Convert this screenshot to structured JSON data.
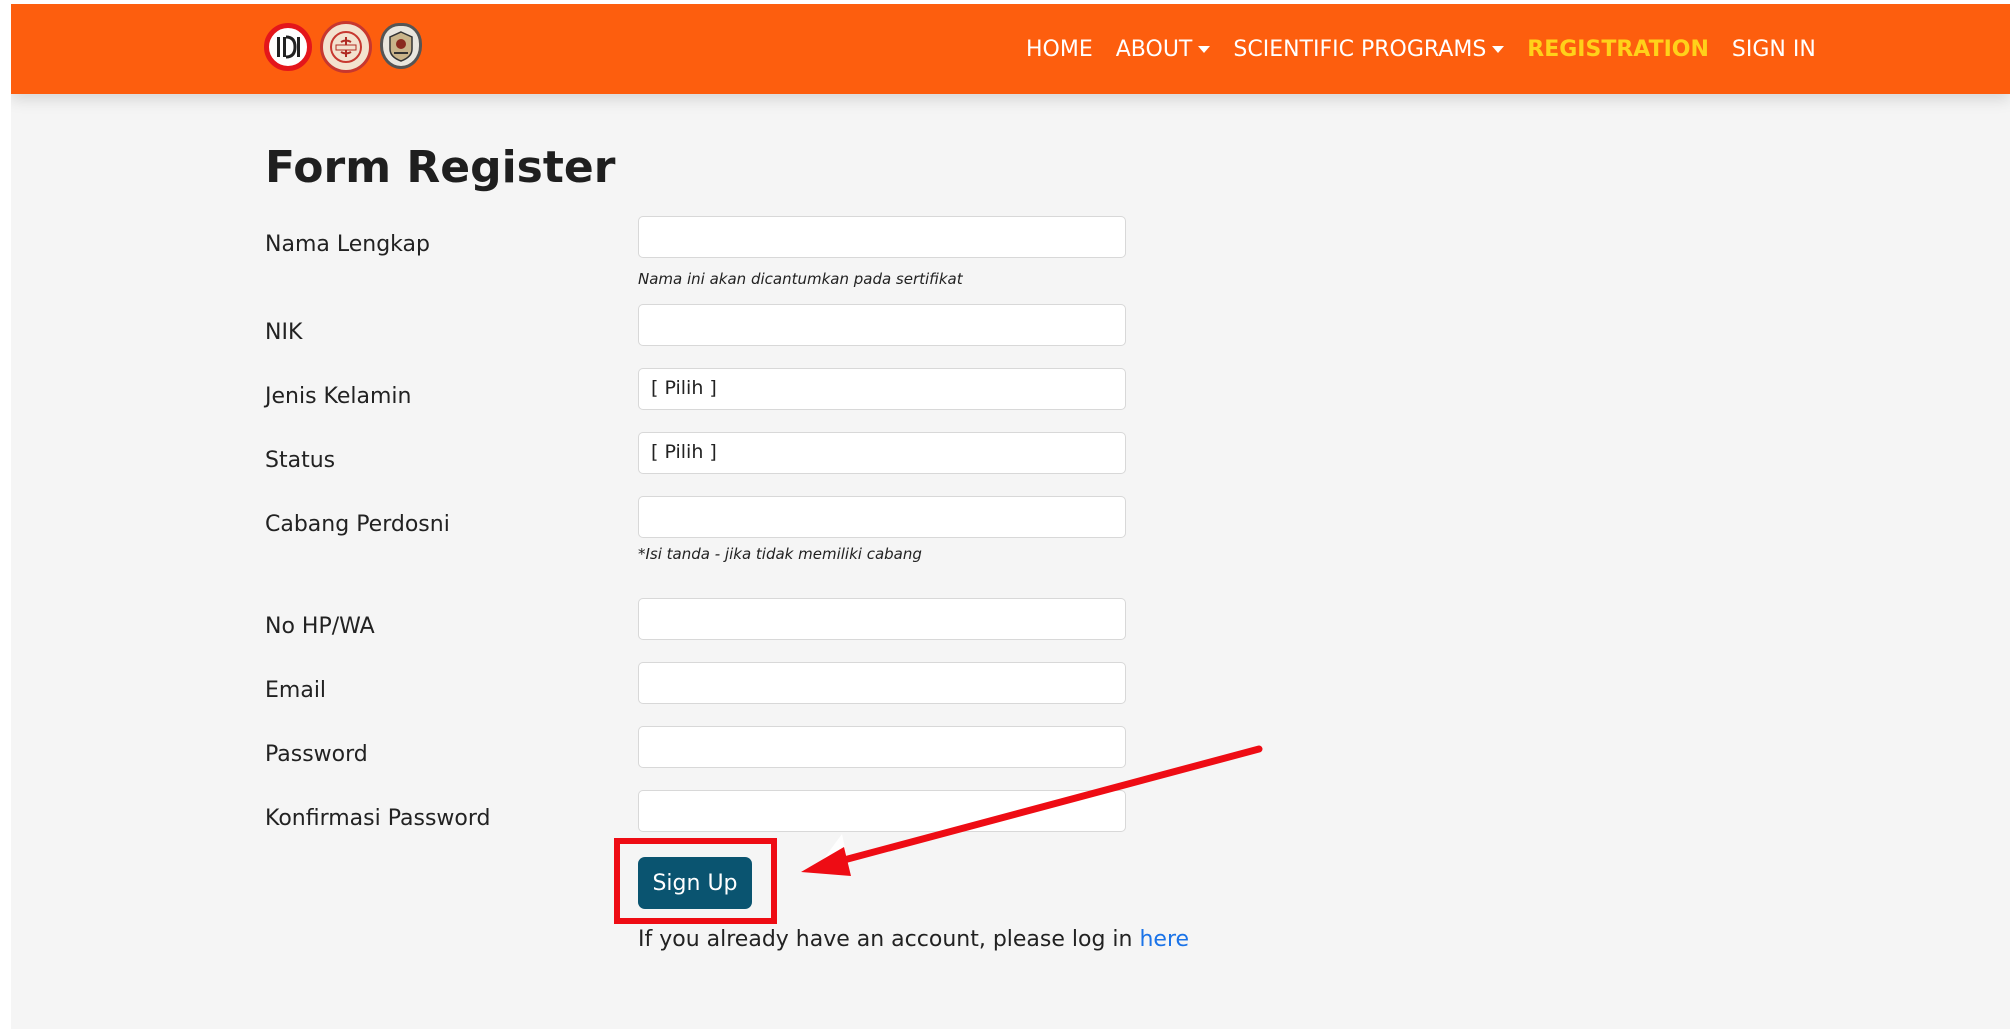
{
  "navbar": {
    "logos": [
      {
        "name": "idi-logo",
        "text": ""
      },
      {
        "name": "perdosni-logo",
        "text": ""
      },
      {
        "name": "university-logo",
        "text": ""
      }
    ],
    "links": [
      {
        "label": "HOME",
        "dropdown": false,
        "active": false
      },
      {
        "label": "ABOUT",
        "dropdown": true,
        "active": false
      },
      {
        "label": "SCIENTIFIC PROGRAMS",
        "dropdown": true,
        "active": false
      },
      {
        "label": "REGISTRATION",
        "dropdown": false,
        "active": true
      },
      {
        "label": "SIGN IN",
        "dropdown": false,
        "active": false
      }
    ],
    "colors": {
      "background": "#fd5e0e",
      "active": "#ffd11a"
    }
  },
  "form": {
    "title": "Form Register",
    "fields": {
      "nama": {
        "label": "Nama Lengkap",
        "value": "",
        "hint": "Nama ini akan dicantumkan pada sertifikat"
      },
      "nik": {
        "label": "NIK",
        "value": ""
      },
      "jenis_kelamin": {
        "label": "Jenis Kelamin",
        "selected": "[ Pilih ]"
      },
      "status": {
        "label": "Status",
        "selected": "[ Pilih ]"
      },
      "cabang": {
        "label": "Cabang Perdosni",
        "value": "",
        "hint": "*Isi tanda - jika tidak memiliki cabang"
      },
      "hp": {
        "label": "No HP/WA",
        "value": ""
      },
      "email": {
        "label": "Email",
        "value": ""
      },
      "password": {
        "label": "Password",
        "value": ""
      },
      "konfirmasi": {
        "label": "Konfirmasi Password",
        "value": ""
      }
    },
    "submit_label": "Sign Up",
    "login_prompt": "If you already have an account, please log in ",
    "login_link": "here",
    "colors": {
      "button": "#0a5470",
      "link": "#1a73e8"
    }
  },
  "annotation": {
    "color": "#ee0c14"
  }
}
